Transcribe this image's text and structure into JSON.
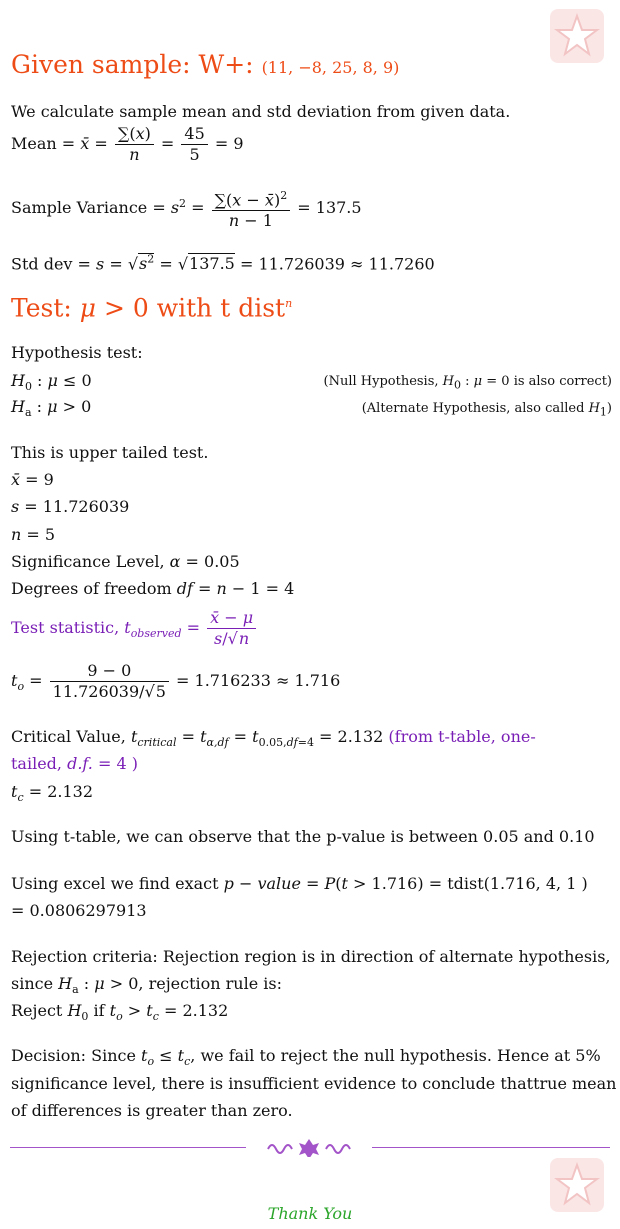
{
  "heading1": {
    "label": "Given sample: W+:",
    "sample": "(11, −8, 25, 8, 9)"
  },
  "intro": "We calculate sample mean and std deviation from given data.",
  "mean": {
    "label": "Mean",
    "num": "45",
    "den": "5",
    "result": "9"
  },
  "variance": {
    "label": "Sample Variance",
    "result": "137.5"
  },
  "stddev": {
    "label": "Std dev",
    "inner": "137.5",
    "value": "11.726039",
    "approx": "11.7260"
  },
  "heading2": {
    "label": "Test:",
    "with": "with t dist"
  },
  "hypothesis": {
    "title": "Hypothesis test:",
    "null_note_pre": "(Null Hypothesis,",
    "null_note_post": "is also correct)",
    "alt_note": "(Alternate Hypothesis, also called"
  },
  "test_type": "This is upper tailed test.",
  "given": {
    "xbar": "9",
    "s": "11.726039",
    "n": "5",
    "alpha_label": "Significance Level,",
    "alpha": "0.05",
    "df_label": "Degrees of freedom",
    "df": "4"
  },
  "test_statistic_label": "Test statistic,",
  "t_calc": {
    "num": "9 − 0",
    "den_value": "11.726039",
    "den_sqrt": "5",
    "result": "1.716233",
    "approx": "1.716"
  },
  "critical": {
    "label": "Critical Value,",
    "alpha": "0.05",
    "df": "4",
    "value": "2.132",
    "note_1": "(from t-table, one-",
    "note_2": "tailed,",
    "note_df": "4",
    "tc": "2.132"
  },
  "pvalue_table": "Using t-table, we can observe that the p-value is between 0.05 and 0.10",
  "excel": {
    "pre": "Using excel we find exact",
    "t": "1.716",
    "func": "tdist(1.716, 4, 1 )",
    "result": "= 0.0806297913"
  },
  "rejection": {
    "line1": "Rejection criteria: Rejection region is in direction of alternate hypothesis,",
    "line2_pre": "since",
    "line2_post": ", rejection rule is:",
    "line3_pre": "Reject",
    "line3_mid": "if",
    "tc": "2.132"
  },
  "decision": {
    "line1_pre": "Decision: Since",
    "line1_post": ", we fail to reject the null hypothesis. Hence at 5%",
    "line2": "significance level, there is insufficient evidence to conclude thattrue mean",
    "line3": "of differences is greater than zero."
  },
  "closing": "Thank You",
  "colors": {
    "heading": "#ee4c17",
    "accent": "#7a1fb6",
    "closing": "#2aa52a",
    "logo": "#f7d6d6"
  }
}
